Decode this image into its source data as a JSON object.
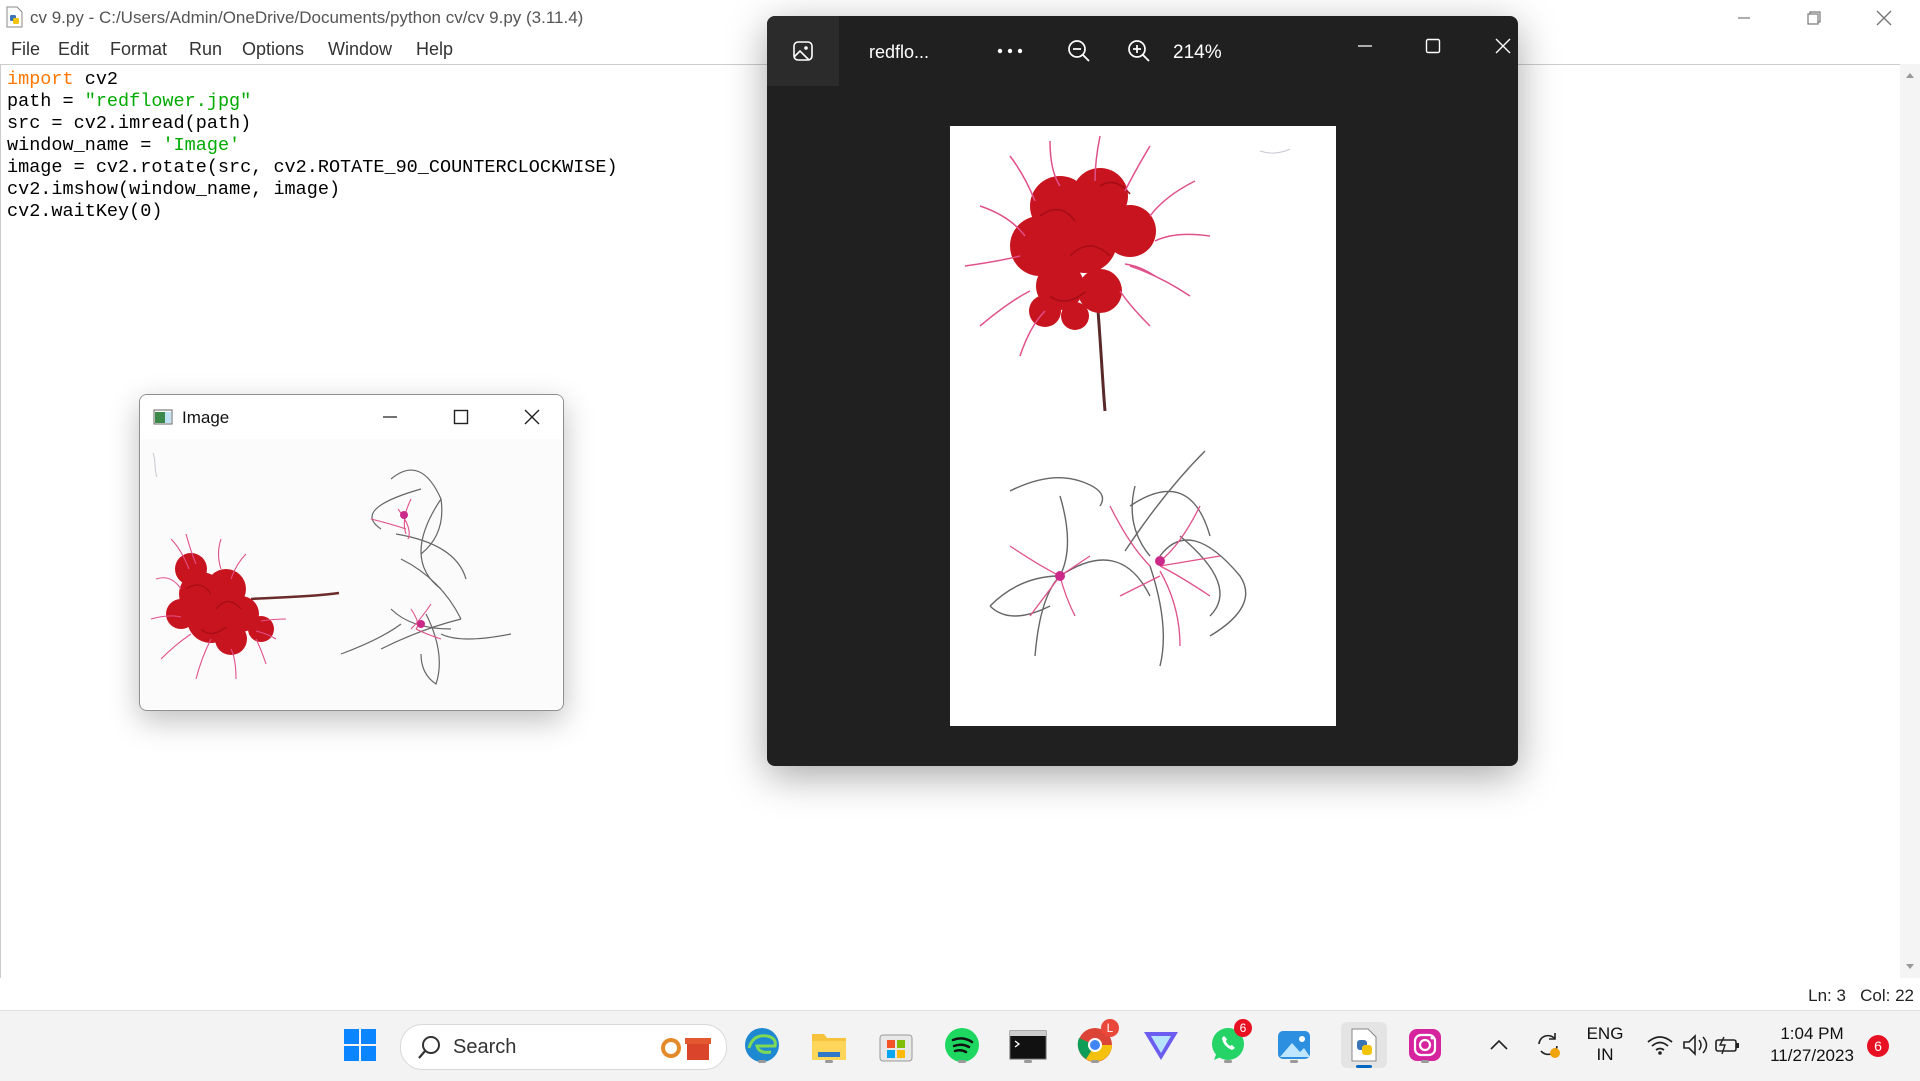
{
  "idle": {
    "title": "cv 9.py - C:/Users/Admin/OneDrive/Documents/python cv/cv 9.py (3.11.4)",
    "menu": [
      "File",
      "Edit",
      "Format",
      "Run",
      "Options",
      "Window",
      "Help"
    ],
    "code": [
      {
        "kw": "import",
        "rest": " cv2"
      },
      {
        "pre": "path = ",
        "str": "\"redflower.jpg\""
      },
      {
        "plain": "src = cv2.imread(path)"
      },
      {
        "pre": "window_name = ",
        "str": "'Image'"
      },
      {
        "plain": "image = cv2.rotate(src, cv2.ROTATE_90_COUNTERCLOCKWISE)"
      },
      {
        "plain": "cv2.imshow(window_name, image)"
      },
      {
        "plain": "cv2.waitKey(0)"
      }
    ],
    "status": {
      "ln": "Ln: 3",
      "col": "Col: 22"
    }
  },
  "cv_window": {
    "title": "Image"
  },
  "photos": {
    "title": "redflo...",
    "zoom": "214%"
  },
  "taskbar": {
    "search_label": "Search",
    "lang_top": "ENG",
    "lang_bottom": "IN",
    "time": "1:04 PM",
    "date": "11/27/2023",
    "notification_count": "6",
    "whatsapp_badge": "6",
    "chrome_badge": "L"
  },
  "colors": {
    "accent": "#0067c0",
    "flower_red": "#c8141e",
    "petal_pink": "#e0508a",
    "keyword": "#ff7700",
    "string": "#00aa00"
  }
}
